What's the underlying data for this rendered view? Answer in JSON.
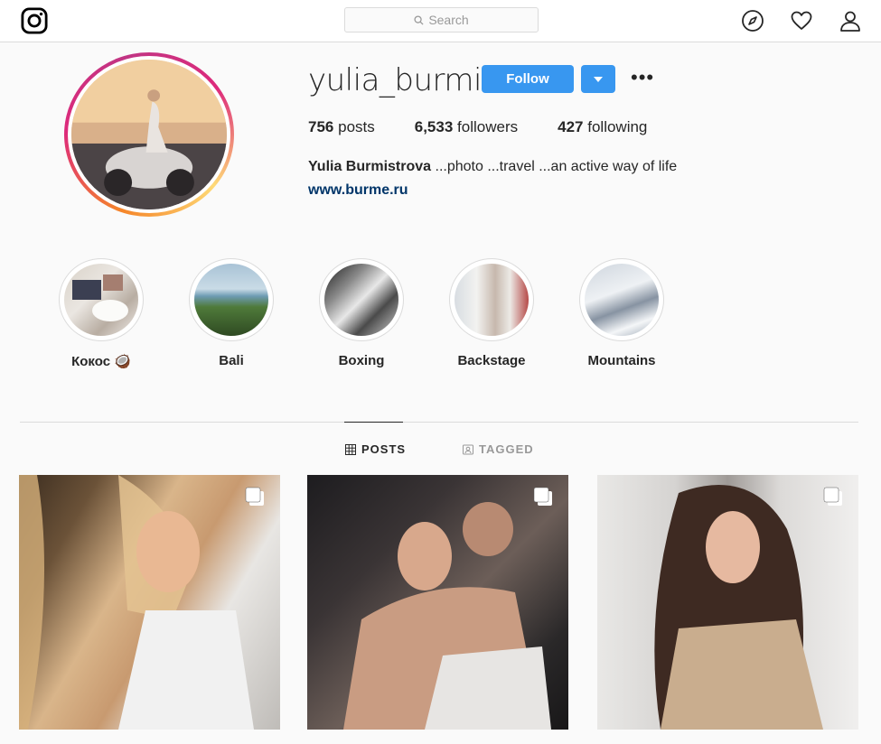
{
  "nav": {
    "search_placeholder": "Search"
  },
  "profile": {
    "username": "yulia_burmi",
    "follow_label": "Follow",
    "more_label": "•••",
    "posts_count": "756",
    "posts_label": "posts",
    "followers_count": "6,533",
    "followers_label": "followers",
    "following_count": "427",
    "following_label": "following",
    "full_name": "Yulia Burmistrova",
    "bio": " ...photo ...travel ...an active way of life",
    "website": "www.burme.ru"
  },
  "highlights": [
    {
      "label": "Кокос 🥥"
    },
    {
      "label": "Bali"
    },
    {
      "label": "Boxing"
    },
    {
      "label": "Backstage"
    },
    {
      "label": "Mountains"
    }
  ],
  "tabs": {
    "posts": "POSTS",
    "tagged": "TAGGED"
  },
  "colors": {
    "accent": "#3897f0",
    "link": "#003569",
    "border": "#dbdbdb"
  },
  "icons": [
    "instagram-logo-icon",
    "search-icon",
    "explore-compass-icon",
    "heart-icon",
    "profile-icon",
    "grid-icon",
    "tagged-icon",
    "multi-photo-icon"
  ]
}
